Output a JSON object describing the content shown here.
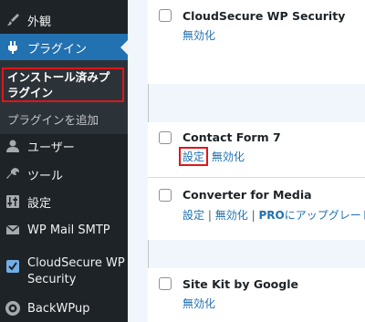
{
  "sidebar": {
    "items": [
      {
        "label": "外観",
        "icon": "paintbrush-icon"
      },
      {
        "label": "プラグイン",
        "icon": "plugin-icon"
      },
      {
        "label": "ユーザー",
        "icon": "user-icon"
      },
      {
        "label": "ツール",
        "icon": "wrench-icon"
      },
      {
        "label": "設定",
        "icon": "settings-sliders-icon"
      },
      {
        "label": "WP Mail SMTP",
        "icon": "mail-icon"
      },
      {
        "label": "CloudSecure WP Security",
        "icon": "shield-check-icon"
      },
      {
        "label": "BackWPup",
        "icon": "backwpup-icon"
      }
    ],
    "submenu": {
      "current": "インストール済みプラグイン",
      "add": "プラグインを追加"
    }
  },
  "plugins": [
    {
      "name": "CloudSecure WP Security",
      "actions": {
        "deactivate": "無効化"
      }
    },
    {
      "name": "Contact Form 7",
      "actions": {
        "settings": "設定",
        "deactivate": "無効化"
      }
    },
    {
      "name": "Converter for Media",
      "actions": {
        "settings": "設定",
        "sep": "|",
        "deactivate": "無効化",
        "pro": "PRO",
        "upgrade": "にアップグレード"
      }
    },
    {
      "name": "Site Kit by Google",
      "actions": {
        "deactivate": "無効化"
      }
    }
  ],
  "colors": {
    "sidebar_bg": "#1d2327",
    "active": "#2271b1",
    "highlight": "#e0151b",
    "link": "#2271b1"
  }
}
